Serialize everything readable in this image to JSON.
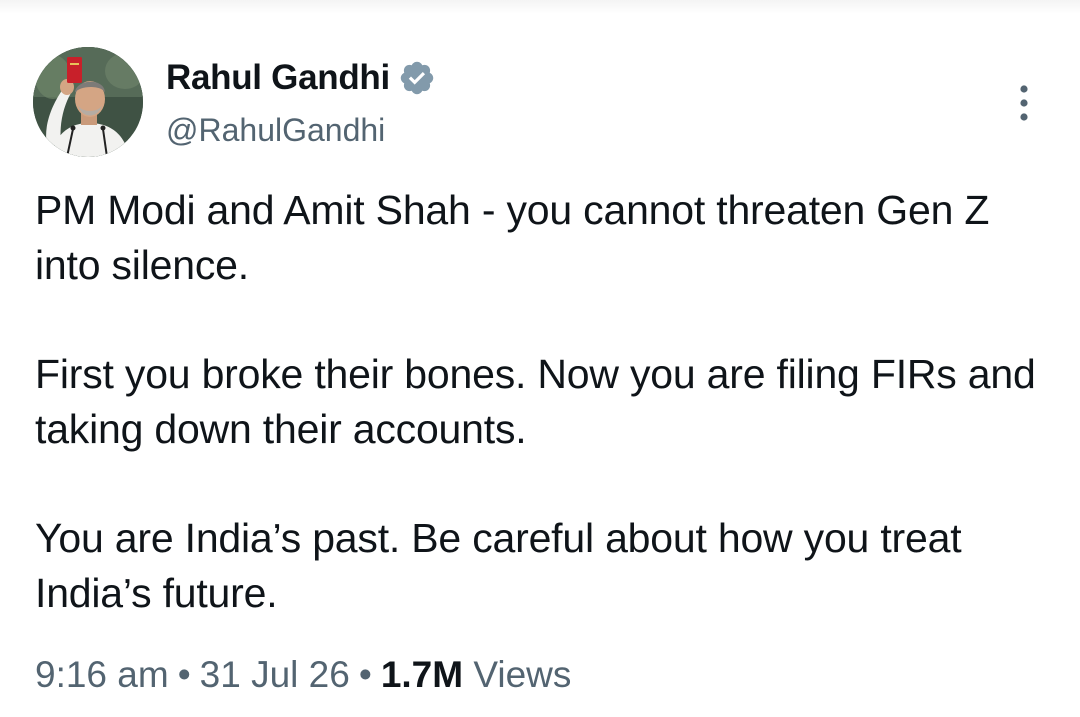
{
  "author": {
    "name": "Rahul Gandhi",
    "handle": "@RahulGandhi",
    "verified": true,
    "avatar_icon": "profile-photo",
    "verified_icon": "verified-badge-icon"
  },
  "menu": {
    "icon": "more-options-icon"
  },
  "tweet": {
    "paragraphs": [
      "PM Modi and Amit Shah - you cannot threaten Gen Z into silence.",
      "First you broke their bones. Now you are filing FIRs and taking down their accounts.",
      "You are India’s past. Be careful about how you treat India’s future."
    ]
  },
  "meta": {
    "time": "9:16 am",
    "separator": "•",
    "date": "31 Jul 26",
    "views_count": "1.7M",
    "views_label": "Views"
  },
  "colors": {
    "text_primary": "#0f1419",
    "text_secondary": "#536471",
    "verified_badge": "#829aab",
    "background": "#ffffff"
  }
}
